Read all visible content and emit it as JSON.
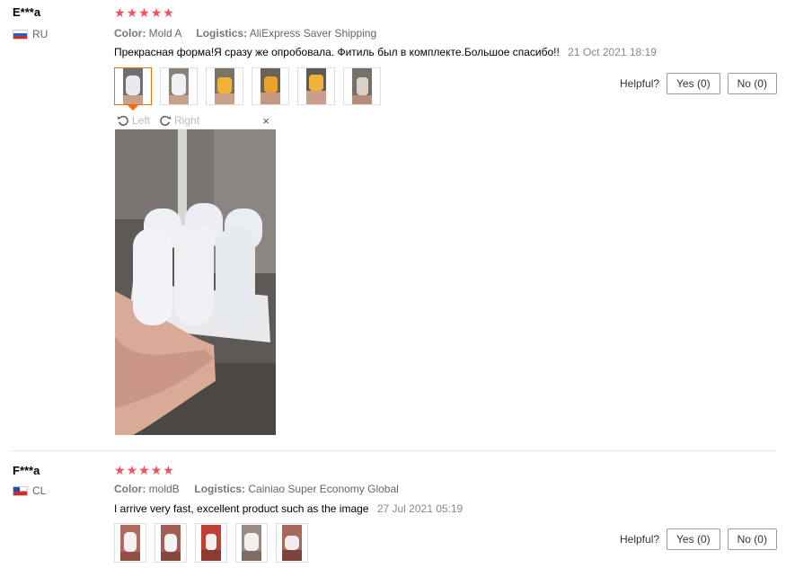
{
  "reviews": [
    {
      "user": "E***a",
      "country": "RU",
      "rating": 5,
      "color_label": "Color:",
      "color_value": "Mold A",
      "logistics_label": "Logistics:",
      "logistics_value": "AliExpress Saver Shipping",
      "text": "Прекрасная форма!Я сразу же опробовала. Фитиль был в комплекте.Большое спасибо!!",
      "date": "21 Oct 2021 18:19",
      "helpful_label": "Helpful?",
      "yes_label": "Yes (0)",
      "no_label": "No (0)",
      "viewer": {
        "left_label": "Left",
        "right_label": "Right",
        "close_label": "×"
      }
    },
    {
      "user": "F***a",
      "country": "CL",
      "rating": 5,
      "color_label": "Color:",
      "color_value": "moldB",
      "logistics_label": "Logistics:",
      "logistics_value": "Cainiao Super Economy Global",
      "text": "I arrive very fast, excellent product such as the image",
      "date": "27 Jul 2021 05:19",
      "helpful_label": "Helpful?",
      "yes_label": "Yes (0)",
      "no_label": "No (0)"
    }
  ],
  "icons": {
    "star": "star-icon",
    "rotate_left": "rotate-left-icon",
    "rotate_right": "rotate-right-icon",
    "close": "close-icon"
  },
  "colors": {
    "star": "#f4515d",
    "active_thumb": "#ff6a00"
  }
}
